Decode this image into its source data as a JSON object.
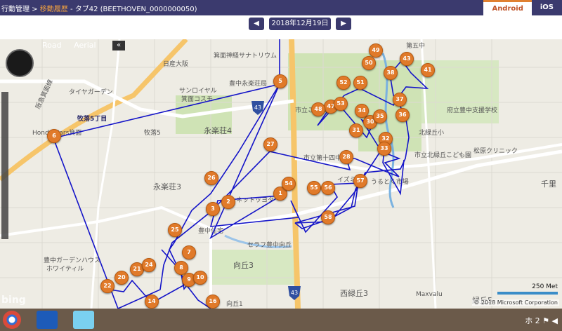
{
  "header": {
    "crumb_root": "行動管理 >",
    "crumb_active": "移動履歴",
    "crumb_tab": " - タブ42 (BEETHOVEN_0000000050)"
  },
  "platform_tabs": [
    "Android",
    "iOS"
  ],
  "date_nav": {
    "prev": "◀",
    "date": "2018年12月19日",
    "next": "▶"
  },
  "map_controls": {
    "road": "Road",
    "aerial": "Aerial",
    "collapse": "«"
  },
  "scale": {
    "label": "250 Met"
  },
  "attribution": "© 2018 Microsoft Corporation",
  "bing": "bing",
  "labels": {
    "l1": "日産大阪",
    "l2": "箕面神経サナトリウム",
    "l3": "サンロイヤル",
    "l4": "箕面コスモ",
    "l5": "豊中永楽荘局",
    "l6": "タイヤガーデン",
    "l7": "阪急箕面線",
    "l8": "牧落5丁目",
    "l9": "Honda Cars箕面",
    "l10": "牧落5",
    "l11": "永楽荘4",
    "l12": "永楽荘3",
    "l13": "ネットッヨタ",
    "l14": "豊中住宅",
    "l15": "セラフ豊中向丘",
    "l16": "向丘3",
    "l17": "豊中ガーデンハウス",
    "l18": "ホワイティル",
    "l19": "市立第十四中",
    "l20": "市立こども",
    "l21": "イズミヤ",
    "l22": "うるとく市場",
    "l23": "府立豊中支援学校",
    "l24": "北緑丘小",
    "l25": "市立北緑丘こども園",
    "l26": "松原クリニック",
    "l27": "第五中",
    "l28": "西緑丘3",
    "l29": "Maxvalu",
    "l30": "緑丘5",
    "l31": "千里",
    "l32": "向丘1"
  },
  "markers": [
    "1",
    "2",
    "3",
    "5",
    "6",
    "7",
    "8",
    "9",
    "10",
    "14",
    "16",
    "20",
    "21",
    "22",
    "24",
    "25",
    "26",
    "27",
    "28",
    "30",
    "31",
    "32",
    "33",
    "34",
    "35",
    "36",
    "37",
    "38",
    "41",
    "43",
    "47",
    "48",
    "49",
    "50",
    "51",
    "52",
    "53",
    "54",
    "55",
    "56",
    "57",
    "58"
  ],
  "route_shields": [
    "43",
    "43"
  ],
  "taskbar": {
    "clock": "ホ 2 ⚑ ◀"
  }
}
